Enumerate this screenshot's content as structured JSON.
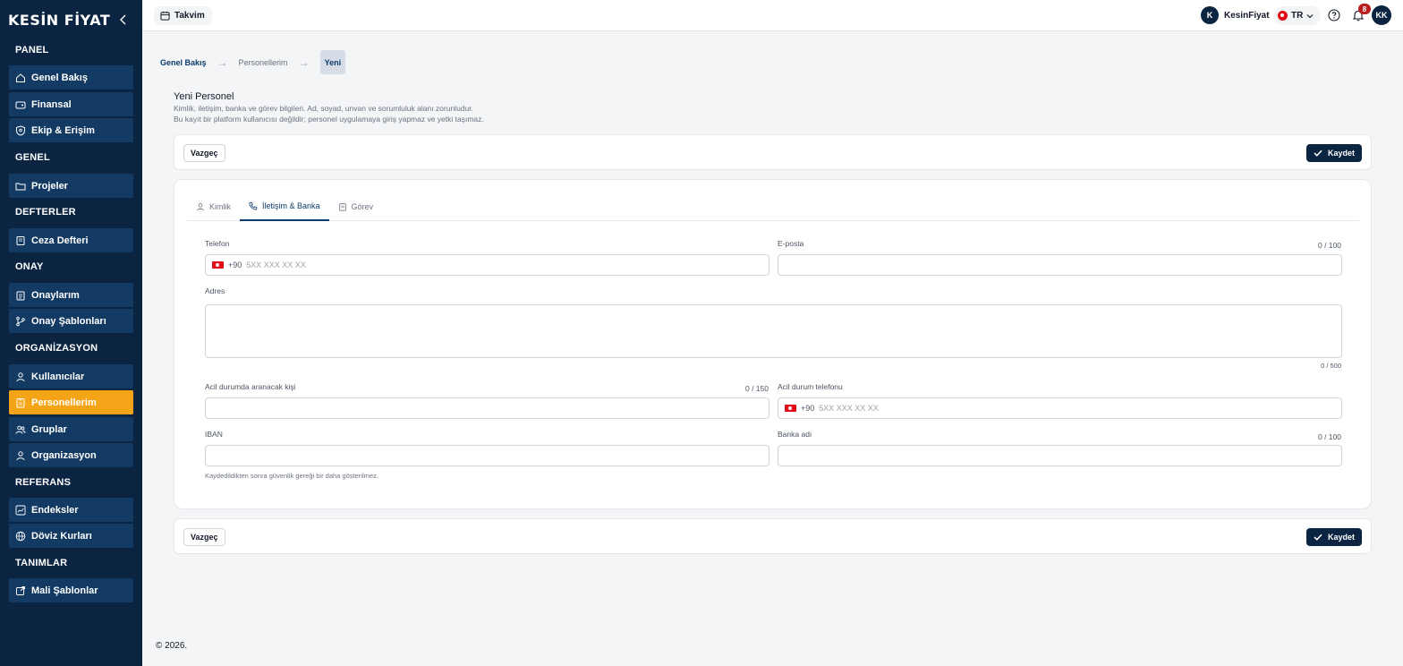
{
  "sidebar": {
    "logo": "KESİN FİYAT",
    "sections": [
      {
        "title": "PANEL",
        "items": [
          {
            "label": "Genel Bakış",
            "icon": "home-icon"
          },
          {
            "label": "Finansal",
            "icon": "wallet-icon"
          },
          {
            "label": "Ekip & Erişim",
            "icon": "shield-icon"
          }
        ]
      },
      {
        "title": "GENEL",
        "items": [
          {
            "label": "Projeler",
            "icon": "folder-icon"
          }
        ]
      },
      {
        "title": "DEFTERLER",
        "items": [
          {
            "label": "Ceza Defteri",
            "icon": "book-icon"
          }
        ]
      },
      {
        "title": "ONAY",
        "items": [
          {
            "label": "Onaylarım",
            "icon": "clipboard-icon"
          },
          {
            "label": "Onay Şablonları",
            "icon": "git-branch-icon"
          }
        ]
      },
      {
        "title": "ORGANİZASYON",
        "items": [
          {
            "label": "Kullanıcılar",
            "icon": "user-icon"
          },
          {
            "label": "Personellerim",
            "icon": "badge-icon",
            "active": true
          },
          {
            "label": "Gruplar",
            "icon": "users-icon"
          },
          {
            "label": "Organizasyon",
            "icon": "org-icon"
          }
        ]
      },
      {
        "title": "REFERANS",
        "items": [
          {
            "label": "Endeksler",
            "icon": "trend-icon"
          },
          {
            "label": "Döviz Kurları",
            "icon": "globe-icon"
          }
        ]
      },
      {
        "title": "TANIMLAR",
        "items": [
          {
            "label": "Mali Şablonlar",
            "icon": "external-icon"
          }
        ]
      }
    ]
  },
  "topbar": {
    "calendar_label": "Takvim",
    "user_initial": "K",
    "user_name": "KesinFiyat",
    "lang": "TR",
    "notification_count": "8",
    "avatar": "KK"
  },
  "breadcrumb": {
    "items": [
      "Genel Bakış",
      "Personellerim"
    ],
    "current": "Yeni"
  },
  "header": {
    "title": "Yeni Personel",
    "desc1": "Kimlik, iletişim, banka ve görev bilgileri. Ad, soyad, unvan ve sorumluluk alanı zorunludur.",
    "desc2": "Bu kayıt bir platform kullanıcısı değildir; personel uygulamaya giriş yapmaz ve yetki taşımaz."
  },
  "actions": {
    "cancel": "Vazgeç",
    "save": "Kaydet"
  },
  "tabs": [
    {
      "label": "Kimlik",
      "icon": "user-icon"
    },
    {
      "label": "İletişim & Banka",
      "icon": "phone-icon",
      "active": true
    },
    {
      "label": "Görev",
      "icon": "clipboard-icon"
    }
  ],
  "form": {
    "phone": {
      "label": "Telefon",
      "dial": "+90",
      "placeholder": "5XX XXX XX XX"
    },
    "email": {
      "label": "E-posta",
      "counter": "0 / 100"
    },
    "address": {
      "label": "Adres",
      "counter": "0 / 500"
    },
    "emergency_person": {
      "label": "Acil durumda aranacak kişi",
      "counter": "0 / 150"
    },
    "emergency_phone": {
      "label": "Acil durum telefonu",
      "dial": "+90",
      "placeholder": "5XX XXX XX XX"
    },
    "iban": {
      "label": "IBAN",
      "hint": "Kaydedildikten sonra güvenlik gereği bir daha gösterilmez."
    },
    "bank": {
      "label": "Banka adı",
      "counter": "0 / 100"
    }
  },
  "footer": "© 2026."
}
